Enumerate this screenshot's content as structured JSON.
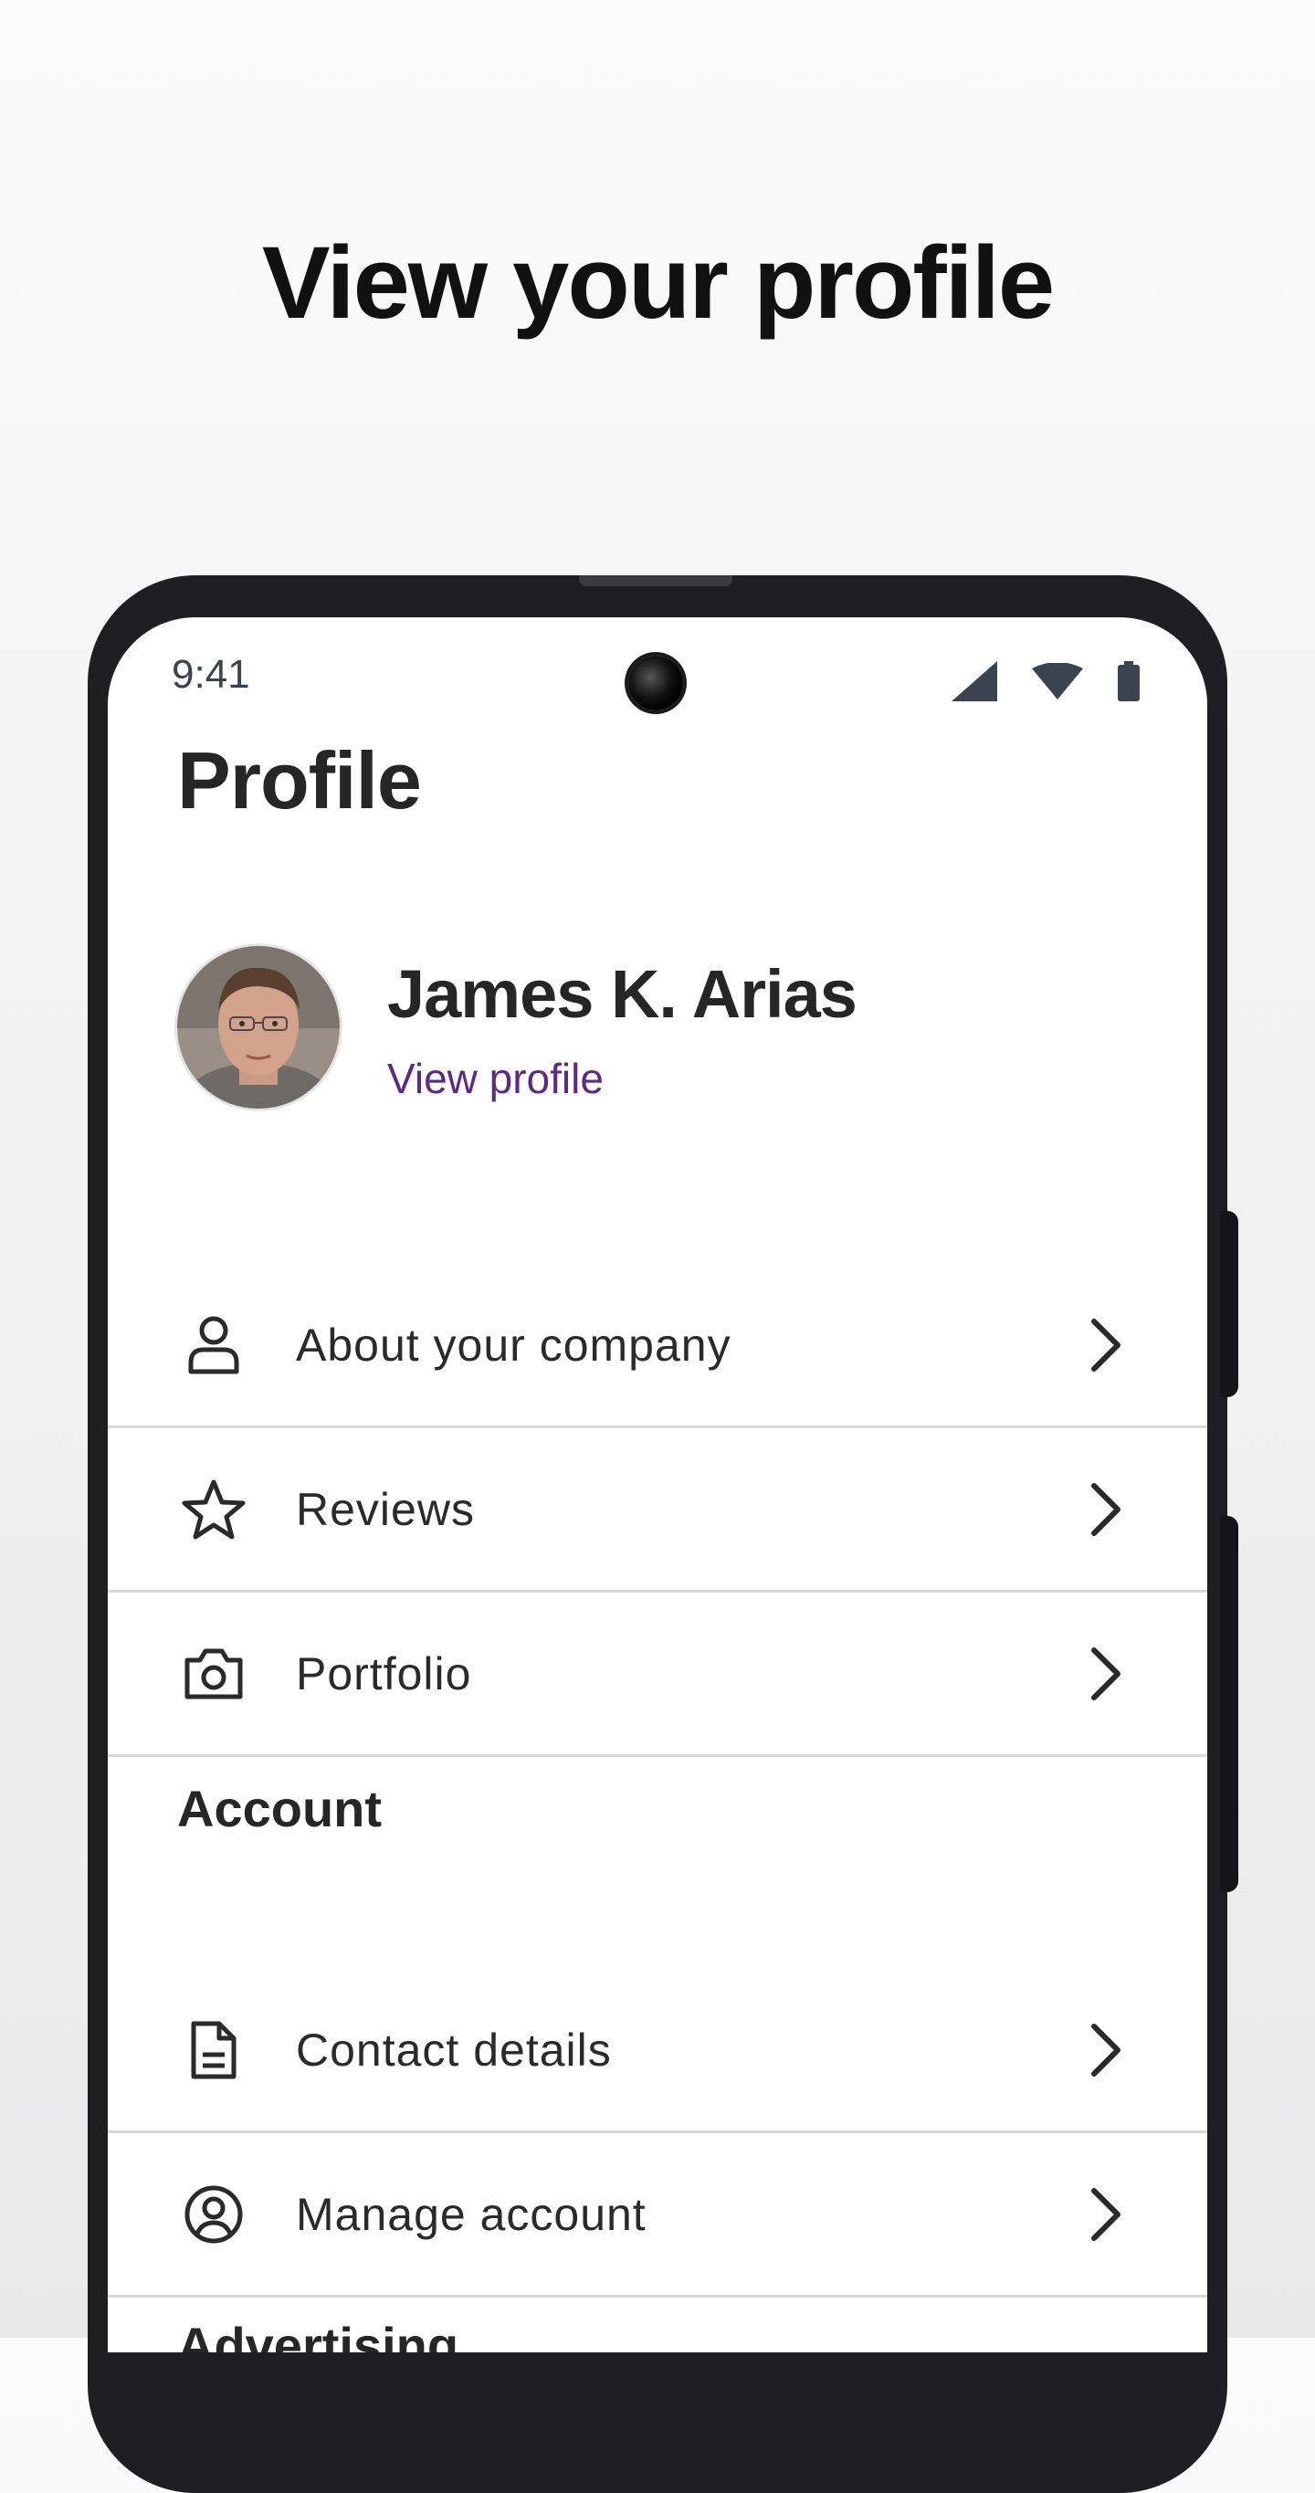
{
  "headline": "View your profile",
  "status_bar": {
    "time": "9:41"
  },
  "page_title": "Profile",
  "profile": {
    "name": "James K. Arias",
    "link_label": "View profile"
  },
  "menu_items": [
    {
      "label": "About your company",
      "icon": "person-icon"
    },
    {
      "label": "Reviews",
      "icon": "star-icon"
    },
    {
      "label": "Portfolio",
      "icon": "camera-icon"
    }
  ],
  "account_section": {
    "title": "Account",
    "items": [
      {
        "label": "Contact details",
        "icon": "document-icon"
      },
      {
        "label": "Manage account",
        "icon": "account-circle-icon"
      }
    ]
  },
  "next_section_partial": "Advertising",
  "colors": {
    "link": "#5c2a86",
    "text": "#262626",
    "divider": "#d8d8d8",
    "phone_frame": "#1f1f22"
  }
}
